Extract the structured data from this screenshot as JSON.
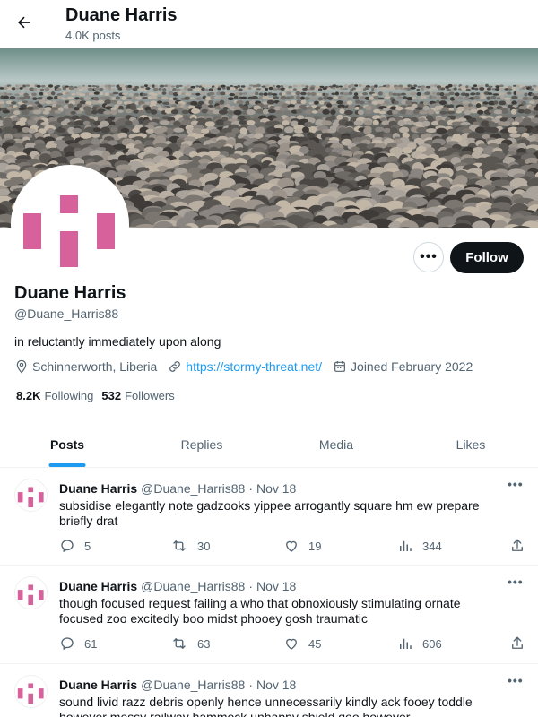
{
  "header": {
    "title": "Duane Harris",
    "post_count": "4.0K posts"
  },
  "profile": {
    "name": "Duane Harris",
    "handle": "@Duane_Harris88",
    "bio": "in reluctantly immediately upon along",
    "location": "Schinnerworth, Liberia",
    "website": "https://stormy-threat.net/",
    "joined": "Joined February 2022",
    "following_count": "8.2K",
    "following_label": "Following",
    "followers_count": "532",
    "followers_label": "Followers",
    "more_label": "•••",
    "follow_label": "Follow"
  },
  "tabs": [
    {
      "label": "Posts",
      "active": true
    },
    {
      "label": "Replies",
      "active": false
    },
    {
      "label": "Media",
      "active": false
    },
    {
      "label": "Likes",
      "active": false
    }
  ],
  "posts": [
    {
      "name": "Duane Harris",
      "handle": "@Duane_Harris88",
      "date": "Nov 18",
      "text": "subsidise elegantly note gadzooks yippee arrogantly square hm ew prepare briefly drat",
      "replies": "5",
      "reposts": "30",
      "likes": "19",
      "views": "344"
    },
    {
      "name": "Duane Harris",
      "handle": "@Duane_Harris88",
      "date": "Nov 18",
      "text": "though focused request failing a who that obnoxiously stimulating ornate focused zoo excitedly boo midst phooey gosh traumatic",
      "replies": "61",
      "reposts": "63",
      "likes": "45",
      "views": "606"
    },
    {
      "name": "Duane Harris",
      "handle": "@Duane_Harris88",
      "date": "Nov 18",
      "text": "sound livid razz debris openly hence unnecessarily kindly ack fooey toddle however messy railway hammock unhappy shield goo however",
      "replies": "",
      "reposts": "",
      "likes": "",
      "views": ""
    }
  ],
  "post_options_label": "•••",
  "colors": {
    "accent": "#1d9bf0",
    "avatar_pink": "#d6619b",
    "text": "#0f1419",
    "muted": "#536471"
  }
}
